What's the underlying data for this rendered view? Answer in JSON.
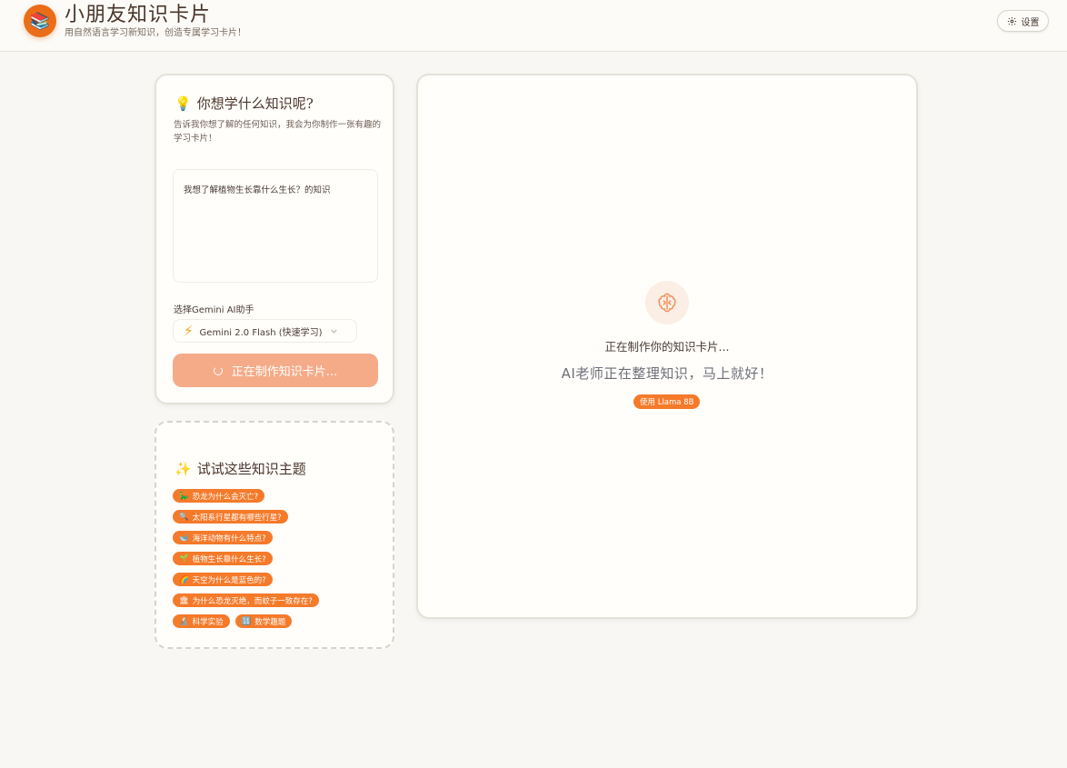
{
  "header": {
    "logo_icon": "books-icon",
    "title": "小朋友知识卡片",
    "subtitle": "用自然语言学习新知识，创造专属学习卡片！",
    "settings_label": "设置"
  },
  "input_panel": {
    "icon": "💡",
    "heading": "你想学什么知识呢?",
    "description": "告诉我你想了解的任何知识，我会为你制作一张有趣的学习卡片！",
    "input_value": "我想了解植物生长靠什么生长？的知识",
    "model_label": "选择Gemini AI助手",
    "model_icon": "⚡",
    "model_selected": "Gemini 2.0 Flash (快速学习)",
    "generate_label": "正在制作知识卡片..."
  },
  "topics_panel": {
    "icon": "✨",
    "heading": "试试这些知识主题",
    "chips": [
      {
        "icon": "🦕",
        "label": "恐龙为什么会灭亡?"
      },
      {
        "icon": "🔍",
        "label": "太阳系行星都有哪些行星?"
      },
      {
        "icon": "🐋",
        "label": "海洋动物有什么特点?"
      },
      {
        "icon": "🌱",
        "label": "植物生长靠什么生长?"
      },
      {
        "icon": "🌈",
        "label": "天空为什么是蓝色的?"
      },
      {
        "icon": "🏛",
        "label": "为什么恐龙灭绝，而蚊子一致存在?"
      }
    ],
    "chips_row": [
      {
        "icon": "🔬",
        "label": "科学实验"
      },
      {
        "icon": "🔢",
        "label": "数学趣题"
      }
    ]
  },
  "result_panel": {
    "loading_title": "正在制作你的知识卡片...",
    "loading_subtitle": "AI老师正在整理知识，马上就好！",
    "model_badge": "使用 Llama 8B"
  },
  "colors": {
    "accent": "#f57a2a",
    "button_disabled": "#f5ab88",
    "background": "#f8f7f3"
  }
}
